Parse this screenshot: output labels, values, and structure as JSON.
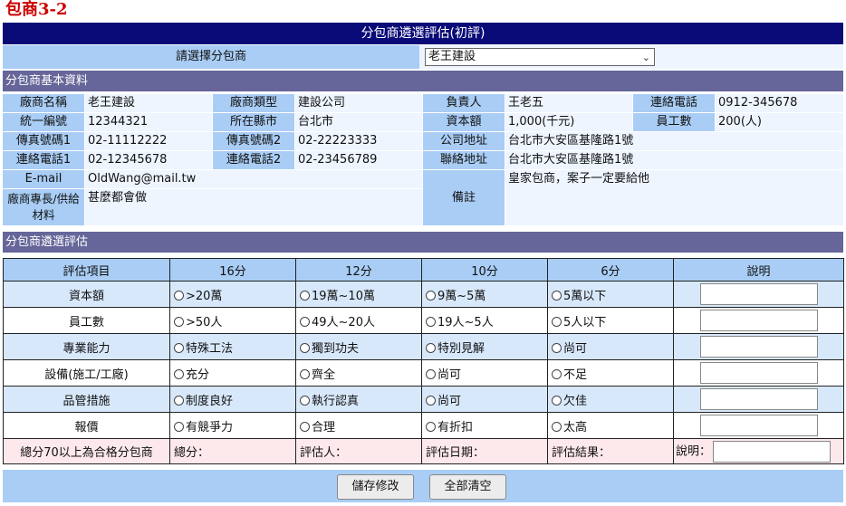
{
  "page_title": "包商3-2",
  "banner": "分包商遴選評估(初評)",
  "selector": {
    "label": "請選擇分包商",
    "value": "老王建設"
  },
  "basic_section": "分包商基本資料",
  "basic": {
    "name_label": "廠商名稱",
    "name": "老王建設",
    "type_label": "廠商類型",
    "type": "建設公司",
    "owner_label": "負責人",
    "owner": "王老五",
    "phone_label": "連絡電話",
    "phone": "0912-345678",
    "taxid_label": "統一編號",
    "taxid": "12344321",
    "county_label": "所在縣市",
    "county": "台北市",
    "capital_label": "資本額",
    "capital": "1,000(千元)",
    "staff_label": "員工數",
    "staff": "200(人)",
    "fax1_label": "傳真號碼1",
    "fax1": "02-11112222",
    "fax2_label": "傳真號碼2",
    "fax2": "02-22223333",
    "co_addr_label": "公司地址",
    "co_addr": "台北市大安區基隆路1號",
    "tel1_label": "連絡電話1",
    "tel1": "02-12345678",
    "tel2_label": "連絡電話2",
    "tel2": "02-23456789",
    "mail_addr_label": "聯絡地址",
    "mail_addr": "台北市大安區基隆路1號",
    "email_label": "E-mail",
    "email": "OldWang@mail.tw",
    "remark_label": "備註",
    "remark": "皇家包商，案子一定要給他",
    "spec_label": "廠商專長/供給材料",
    "spec": "甚麼都會做"
  },
  "eval_section": "分包商遴選評估",
  "eval": {
    "headers": [
      "評估項目",
      "16分",
      "12分",
      "10分",
      "6分",
      "說明"
    ],
    "rows": [
      {
        "item": "資本額",
        "options": [
          ">20萬",
          "19萬~10萬",
          "9萬~5萬",
          "5萬以下"
        ]
      },
      {
        "item": "員工數",
        "options": [
          ">50人",
          "49人~20人",
          "19人~5人",
          "5人以下"
        ]
      },
      {
        "item": "專業能力",
        "options": [
          "特殊工法",
          "獨到功夫",
          "特別見解",
          "尚可"
        ]
      },
      {
        "item": "設備(施工/工廠)",
        "options": [
          "充分",
          "齊全",
          "尚可",
          "不足"
        ]
      },
      {
        "item": "品管措施",
        "options": [
          "制度良好",
          "執行認真",
          "尚可",
          "欠佳"
        ]
      },
      {
        "item": "報價",
        "options": [
          "有競爭力",
          "合理",
          "有折扣",
          "太高"
        ]
      }
    ],
    "summary": {
      "pass_note": "總分70以上為合格分包商",
      "total": "總分：",
      "evaluator": "評估人：",
      "date": "評估日期：",
      "result": "評估結果：",
      "explain": "說明："
    }
  },
  "buttons": {
    "save": "儲存修改",
    "clear": "全部清空"
  }
}
